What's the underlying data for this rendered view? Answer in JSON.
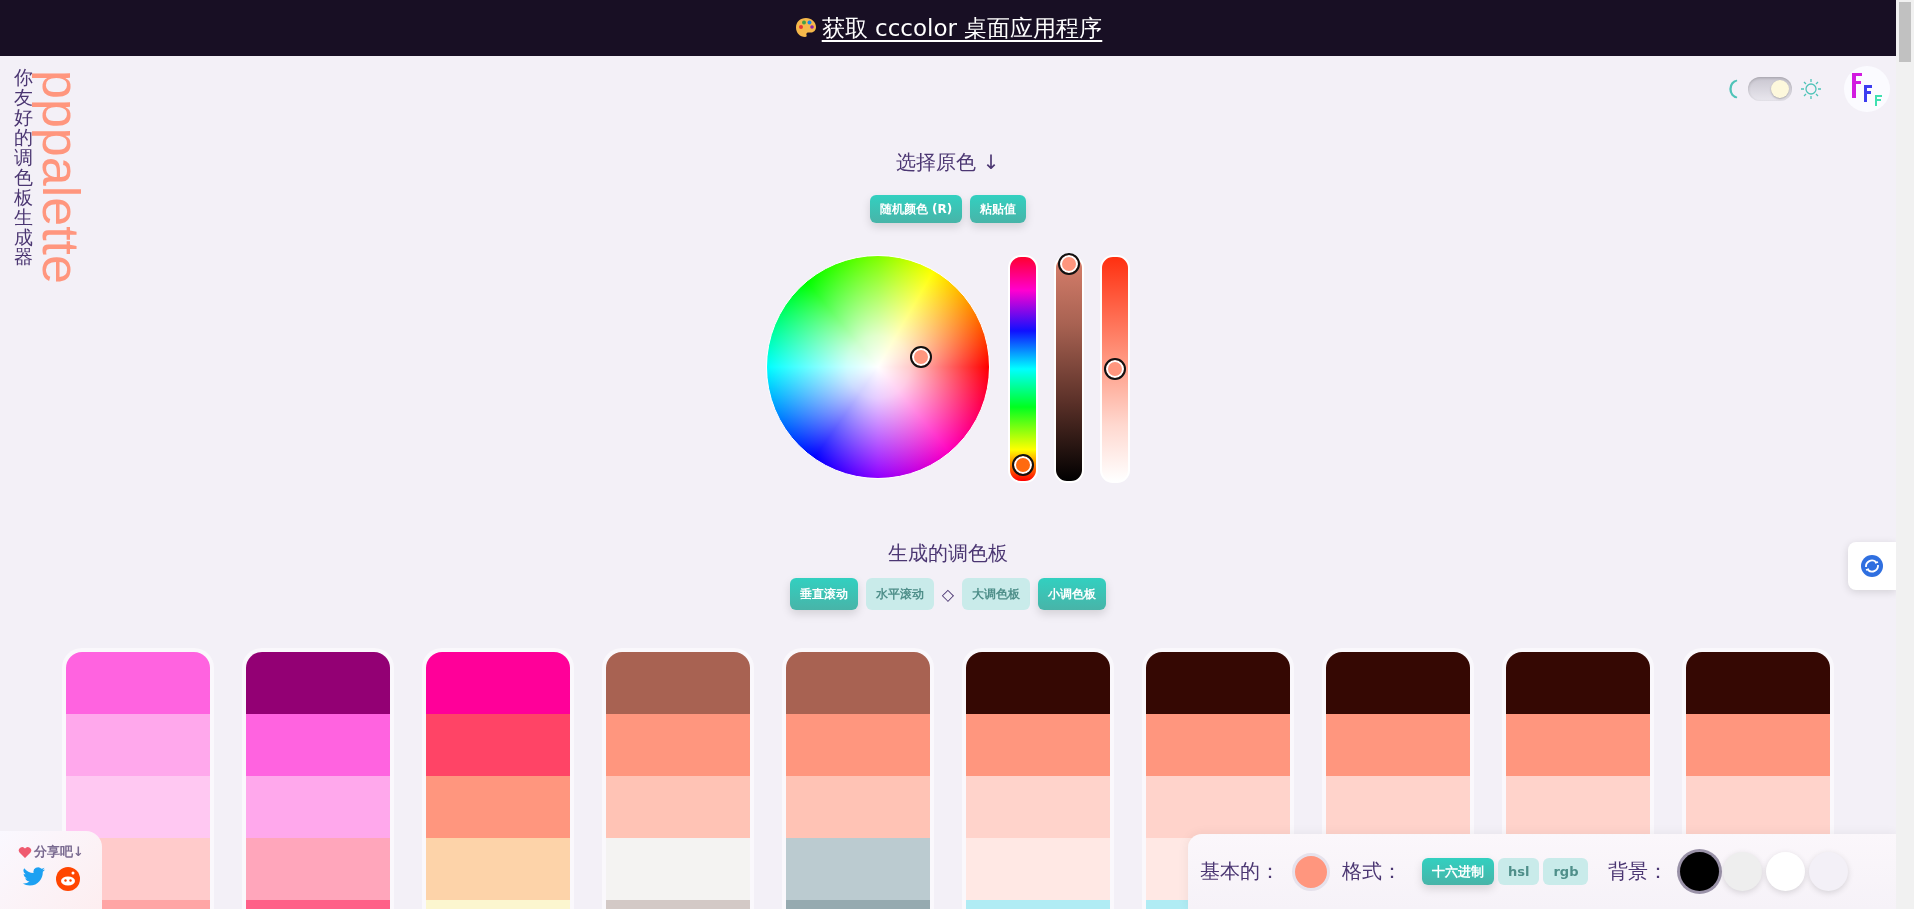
{
  "top_banner": {
    "link": "获取 cccolor 桌面应用程序"
  },
  "brand": {
    "tagline": "你友好的调色板生成器",
    "name": "pppalette"
  },
  "theme_toggle": {
    "on": true
  },
  "picker": {
    "heading": "选择原色 ↓",
    "buttons": [
      "随机颜色 (R)",
      "粘贴值"
    ],
    "sliders": [
      {
        "kind": "hue",
        "level": 0.07
      },
      {
        "kind": "shade",
        "level": 0.97
      },
      {
        "kind": "tint",
        "level": 0.5
      }
    ]
  },
  "palettes": {
    "heading": "生成的调色板",
    "scroll_modes": [
      {
        "label": "垂直滚动",
        "selected": true
      },
      {
        "label": "水平滚动",
        "selected": false
      }
    ],
    "separator": "◇",
    "sizes": [
      {
        "label": "大调色板",
        "selected": false
      },
      {
        "label": "小调色板",
        "selected": true
      }
    ],
    "columns": [
      {
        "swatches": [
          {
            "color": "#ff63e0"
          },
          {
            "color": "#ffa8ec"
          },
          {
            "color": "#ffc8f2"
          },
          {
            "color": "#ffcbcb"
          },
          {
            "color": "#ffa5a5"
          }
        ]
      },
      {
        "swatches": [
          {
            "color": "#930074"
          },
          {
            "color": "#ff63e0"
          },
          {
            "color": "#ffa8ec"
          },
          {
            "color": "#ffa6bb"
          },
          {
            "color": "#ff6088"
          }
        ]
      },
      {
        "swatches": [
          {
            "color": "#ff0099"
          },
          {
            "color": "#ff4466"
          },
          {
            "color": "#ff967e"
          },
          {
            "color": "#fdd3a9"
          },
          {
            "color": "#fcf6cf"
          }
        ]
      },
      {
        "swatches": [
          {
            "color": "#a86252"
          },
          {
            "color": "#ff967e"
          },
          {
            "color": "#ffc3b5"
          },
          {
            "color": "#f4f3f2"
          },
          {
            "color": "#d3c9c6"
          }
        ]
      },
      {
        "swatches": [
          {
            "color": "#a86252"
          },
          {
            "color": "#ff967e"
          },
          {
            "color": "#ffc3b5"
          },
          {
            "color": "#bbcbd0"
          },
          {
            "color": "#96aab0"
          }
        ]
      },
      {
        "swatches": [
          {
            "color": "#350803"
          },
          {
            "color": "#ff967e"
          },
          {
            "color": "#ffd3cb"
          },
          {
            "color": "#ffe8e4"
          },
          {
            "color": "#b0ecf4"
          }
        ]
      },
      {
        "swatches": [
          {
            "color": "#350803"
          },
          {
            "color": "#ff967e"
          },
          {
            "color": "#ffd3cb"
          },
          {
            "color": "#ffe8e4"
          },
          {
            "color": "#b0ecf4"
          }
        ]
      },
      {
        "swatches": [
          {
            "color": "#350803"
          },
          {
            "color": "#ff967e"
          },
          {
            "color": "#ffd3cb"
          }
        ]
      },
      {
        "swatches": [
          {
            "color": "#350803"
          },
          {
            "color": "#ff967e"
          },
          {
            "color": "#ffd3cb"
          }
        ]
      },
      {
        "swatches": [
          {
            "color": "#350803"
          },
          {
            "color": "#ff967e"
          },
          {
            "color": "#ffd3cb"
          }
        ]
      }
    ]
  },
  "share": {
    "label": "分享吧↓"
  },
  "toolbar": {
    "base_label": "基本的：",
    "format_label": "格式：",
    "formats": [
      {
        "label": "十六进制",
        "selected": true
      },
      {
        "label": "hsl",
        "selected": false
      },
      {
        "label": "rgb",
        "selected": false
      }
    ],
    "background_label": "背景：",
    "backgrounds": [
      {
        "color": "#000000",
        "selected": true
      },
      {
        "color": "#eeeeee",
        "selected": false
      },
      {
        "color": "#ffffff",
        "selected": false
      },
      {
        "color": "#f3f0f7",
        "selected": false
      }
    ]
  }
}
